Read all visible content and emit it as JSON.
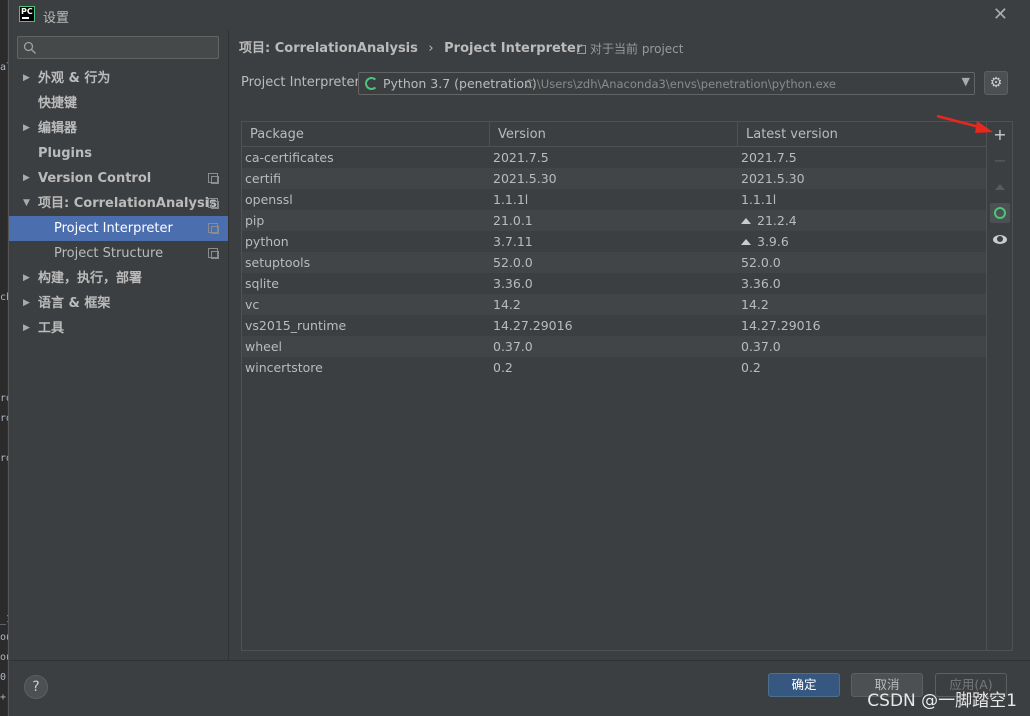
{
  "window": {
    "title": "设置",
    "app_icon_text": "PC"
  },
  "editor_fragments": [
    "al",
    "ch",
    "rd",
    "rd",
    "rd",
    "_1",
    "ou",
    "ou",
    "0",
    "+"
  ],
  "sidebar": {
    "search_placeholder": "",
    "items": [
      {
        "label": "外观 & 行为",
        "arrow": "▶",
        "bold": true
      },
      {
        "label": "快捷键",
        "arrow": "",
        "bold": true
      },
      {
        "label": "编辑器",
        "arrow": "▶",
        "bold": true
      },
      {
        "label": "Plugins",
        "arrow": "",
        "bold": true
      },
      {
        "label": "Version Control",
        "arrow": "▶",
        "bold": true
      },
      {
        "label": "项目: CorrelationAnalysis",
        "arrow": "▼",
        "bold": true
      },
      {
        "label": "Project Interpreter",
        "arrow": "",
        "selected": true
      },
      {
        "label": "Project Structure",
        "arrow": ""
      },
      {
        "label": "构建，执行，部署",
        "arrow": "▶",
        "bold": true
      },
      {
        "label": "语言 & 框架",
        "arrow": "▶",
        "bold": true
      },
      {
        "label": "工具",
        "arrow": "▶",
        "bold": true
      }
    ]
  },
  "header": {
    "breadcrumb_project": "项目: CorrelationAnalysis",
    "breadcrumb_sep": "›",
    "breadcrumb_page": "Project Interpreter",
    "scope_text": "对于当前 project"
  },
  "interpreter": {
    "label": "Project Interpreter:",
    "name": "Python 3.7 (penetration)",
    "path": "C:\\Users\\zdh\\Anaconda3\\envs\\penetration\\python.exe"
  },
  "packages": {
    "columns": [
      "Package",
      "Version",
      "Latest version"
    ],
    "rows": [
      {
        "package": "ca-certificates",
        "version": "2021.7.5",
        "latest": "2021.7.5",
        "upgrade": false
      },
      {
        "package": "certifi",
        "version": "2021.5.30",
        "latest": "2021.5.30",
        "upgrade": false
      },
      {
        "package": "openssl",
        "version": "1.1.1l",
        "latest": "1.1.1l",
        "upgrade": false
      },
      {
        "package": "pip",
        "version": "21.0.1",
        "latest": "21.2.4",
        "upgrade": true
      },
      {
        "package": "python",
        "version": "3.7.11",
        "latest": "3.9.6",
        "upgrade": true
      },
      {
        "package": "setuptools",
        "version": "52.0.0",
        "latest": "52.0.0",
        "upgrade": false
      },
      {
        "package": "sqlite",
        "version": "3.36.0",
        "latest": "3.36.0",
        "upgrade": false
      },
      {
        "package": "vc",
        "version": "14.2",
        "latest": "14.2",
        "upgrade": false
      },
      {
        "package": "vs2015_runtime",
        "version": "14.27.29016",
        "latest": "14.27.29016",
        "upgrade": false
      },
      {
        "package": "wheel",
        "version": "0.37.0",
        "latest": "0.37.0",
        "upgrade": false
      },
      {
        "package": "wincertstore",
        "version": "0.2",
        "latest": "0.2",
        "upgrade": false
      }
    ]
  },
  "toolbar": {
    "add": "+",
    "remove": "−"
  },
  "footer": {
    "help": "?",
    "ok": "确定",
    "cancel": "取消",
    "apply": "应用(A)",
    "watermark": "CSDN @一脚踏空1"
  },
  "colors": {
    "selection": "#4b6eaf",
    "accent_green": "#4ec27a",
    "annotation_red": "#e8281e"
  }
}
